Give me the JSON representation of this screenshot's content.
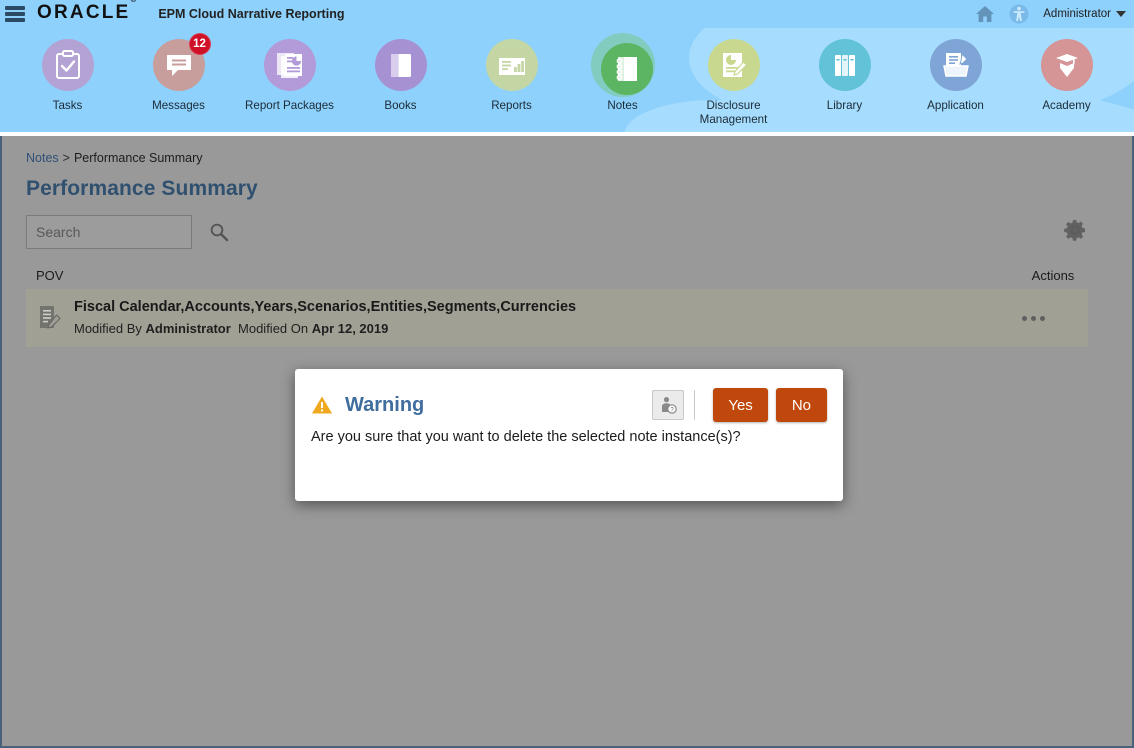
{
  "topbar": {
    "menu_icon": "hamburger-icon",
    "logo": "ORACLE",
    "logo_mark": "®",
    "app_name": "EPM Cloud Narrative Reporting",
    "home_icon": "home-icon",
    "accessibility_icon": "accessibility-icon",
    "user": "Administrator"
  },
  "nav": {
    "items": [
      {
        "label": "Tasks",
        "icon": "clipboard-check-icon",
        "color": "#b3a2d4",
        "active": false,
        "badge": null
      },
      {
        "label": "Messages",
        "icon": "speech-bubble-icon",
        "color": "#c79e9b",
        "active": false,
        "badge": "12"
      },
      {
        "label": "Report Packages",
        "icon": "report-package-icon",
        "color": "#b39ad8",
        "active": false,
        "badge": null
      },
      {
        "label": "Books",
        "icon": "book-icon",
        "color": "#a692d2",
        "active": false,
        "badge": null
      },
      {
        "label": "Reports",
        "icon": "report-chart-icon",
        "color": "#c3d6a4",
        "active": false,
        "badge": null
      },
      {
        "label": "Notes",
        "icon": "notebook-icon",
        "color": "#5bb563",
        "active": true,
        "badge": null
      },
      {
        "label": "Disclosure Management",
        "icon": "disclosure-pie-icon",
        "color": "#c8d98f",
        "active": false,
        "badge": null
      },
      {
        "label": "Library",
        "icon": "library-books-icon",
        "color": "#62c3d8",
        "active": false,
        "badge": null
      },
      {
        "label": "Application",
        "icon": "application-box-icon",
        "color": "#7fa5d6",
        "active": false,
        "badge": null
      },
      {
        "label": "Academy",
        "icon": "academy-graduate-icon",
        "color": "#d59495",
        "active": false,
        "badge": null
      }
    ]
  },
  "breadcrumb": {
    "root": "Notes",
    "separator": ">",
    "current": "Performance Summary"
  },
  "page": {
    "title": "Performance Summary"
  },
  "search": {
    "placeholder": "Search",
    "value": "",
    "search_icon": "magnifier-icon",
    "settings_icon": "gear-icon"
  },
  "table": {
    "columns": {
      "pov": "POV",
      "actions": "Actions"
    },
    "rows": [
      {
        "icon": "note-edit-icon",
        "title": "Fiscal Calendar,Accounts,Years,Scenarios,Entities,Segments,Currencies",
        "modified_by_label": "Modified By",
        "modified_by": "Administrator",
        "modified_on_label": "Modified On",
        "modified_on": "Apr 12, 2019",
        "actions_icon": "ellipsis-icon"
      }
    ]
  },
  "dialog": {
    "icon": "warning-triangle-icon",
    "title": "Warning",
    "message": "Are you sure that you want to delete the selected note instance(s)?",
    "help_icon": "user-help-icon",
    "confirm_label": "Yes",
    "cancel_label": "No"
  },
  "colors": {
    "header_blue": "#8ed1fc",
    "cloud_blue": "#a6dcfd",
    "title_blue": "#30506f",
    "dialog_title_blue": "#3f6d9e",
    "button_orange": "#c0480c",
    "badge_red": "#cf1027",
    "active_green": "#5bb563",
    "dim_grey": "#999999",
    "row_grey": "#a1a094",
    "warning_amber": "#f0a81e"
  }
}
